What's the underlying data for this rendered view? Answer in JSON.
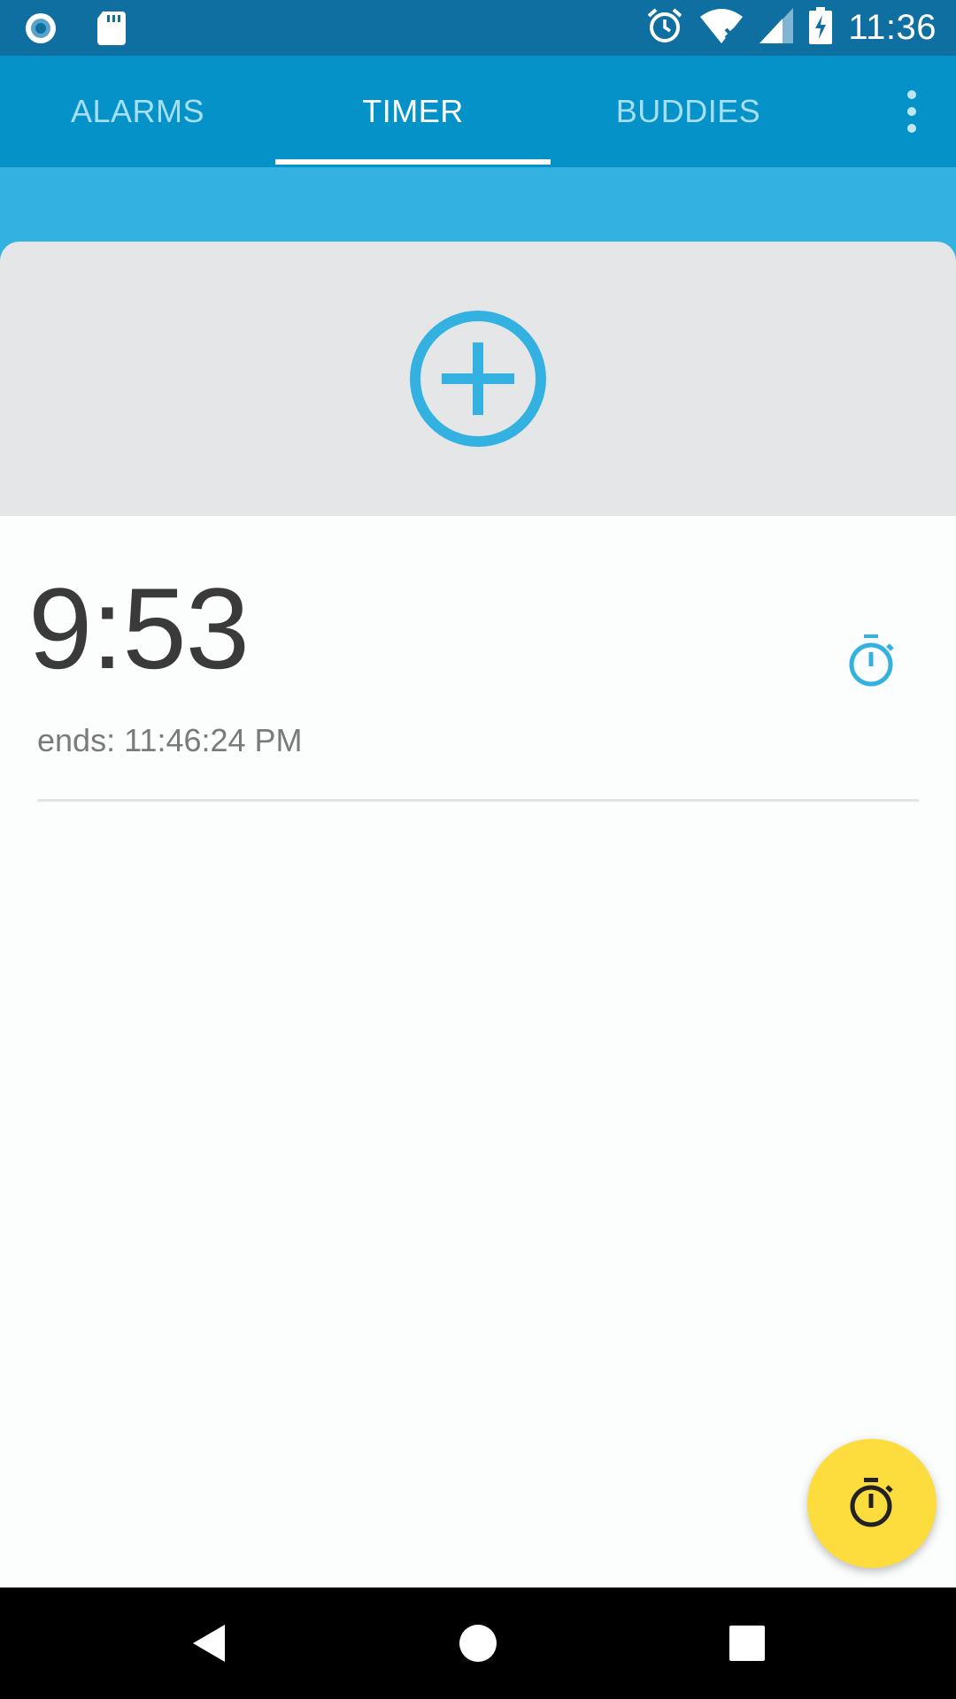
{
  "status_bar": {
    "time": "11:36",
    "left_icons": [
      "record-icon",
      "sd-card-icon"
    ],
    "right_icons": [
      "alarm-icon",
      "wifi-icon",
      "signal-icon",
      "battery-charging-icon"
    ]
  },
  "tabs": [
    {
      "label": "ALARMS",
      "active": false
    },
    {
      "label": "TIMER",
      "active": true
    },
    {
      "label": "BUDDIES",
      "active": false
    }
  ],
  "overflow_icon": "more-vert-icon",
  "add_timer": {
    "icon": "add-circle-icon"
  },
  "timers": [
    {
      "remaining": "9:53",
      "ends": "ends: 11:46:24 PM",
      "icon": "stopwatch-icon"
    }
  ],
  "fab": {
    "icon": "stopwatch-icon"
  },
  "nav": {
    "back_icon": "back-icon",
    "home_icon": "home-icon",
    "recents_icon": "recents-icon"
  },
  "colors": {
    "status_bar": "#0f6fa0",
    "app_bar": "#0592c9",
    "accent": "#33b2e2",
    "fab": "#fddc3e",
    "card": "#e5e6e8"
  }
}
